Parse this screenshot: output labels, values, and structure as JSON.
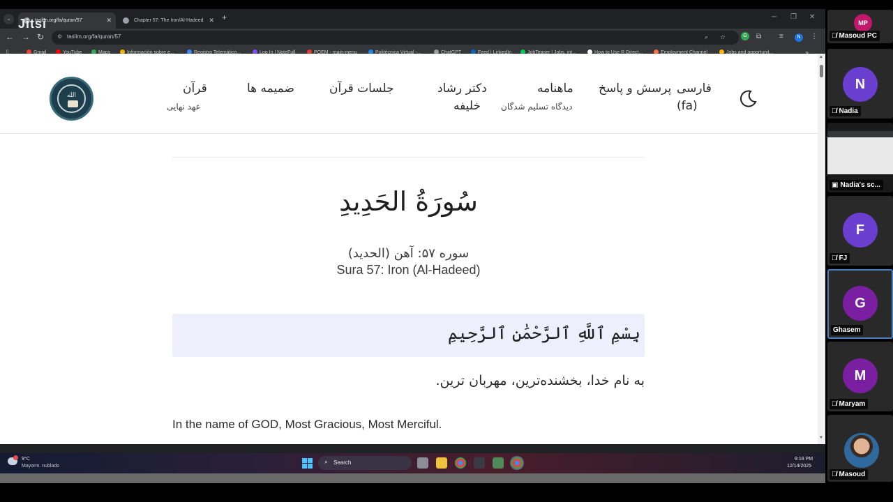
{
  "browser": {
    "tabs": [
      {
        "title": "taslim.org/fa/quran/57",
        "active": true
      },
      {
        "title": "Chapter 57: The Iron/Al-Hadeed",
        "active": false
      }
    ],
    "url": "taslim.org/fa/quran/57",
    "bookmarks": [
      {
        "label": "Gmail",
        "color": "#ea4335"
      },
      {
        "label": "YouTube",
        "color": "#ff0000"
      },
      {
        "label": "Maps",
        "color": "#34a853"
      },
      {
        "label": "Información sobre e...",
        "color": "#f4b400"
      },
      {
        "label": "Registro Telemático...",
        "color": "#4285f4"
      },
      {
        "label": "Log In | NoteFull",
        "color": "#7c4dff"
      },
      {
        "label": "POEM - main-menu",
        "color": "#e53935"
      },
      {
        "label": "Politécnica Virtual -...",
        "color": "#1e88e5"
      },
      {
        "label": "ChatGPT",
        "color": "#9e9e9e"
      },
      {
        "label": "Feed | LinkedIn",
        "color": "#0a66c2"
      },
      {
        "label": "JobTeaser | Jobs, int...",
        "color": "#00c853"
      },
      {
        "label": "How to Use R Direct...",
        "color": "#ffffff"
      },
      {
        "label": "Employment Channel",
        "color": "#ff7043"
      },
      {
        "label": "Jobs and opportunit...",
        "color": "#ffb300"
      }
    ],
    "extensions": [
      "G",
      "N"
    ]
  },
  "jitsi_logo": "Jitsi",
  "site": {
    "nav": {
      "language": "فارسی",
      "language_code": "(fa)",
      "qa": "پرسش و پاسخ",
      "monthly": "ماهنامه",
      "monthly_sub": "دیدگاه تسلیم شدگان",
      "khalifa": "دکتر رشاد",
      "khalifa_2": "خلیفه",
      "sessions": "جلسات قرآن",
      "appendices": "ضمیمه ها",
      "quran": "قرآن",
      "quran_sub": "عهد نهایی"
    },
    "logo_text": "الله"
  },
  "content": {
    "sura_title_ar": "سُورَةُ الحَدِيدِ",
    "sura_sub_fa": "سوره ۵۷: آهن (الحدید)",
    "sura_sub_en": "Sura 57: Iron (Al-Hadeed)",
    "basmala": "بِسْمِ ٱللَّهِ ٱلرَّحْمَٰنِ ٱلرَّحِيمِ",
    "verse_fa": "به نام خدا، بخشنده‌ترین، مهربان ترین.",
    "verse_en": "In the name of GOD, Most Gracious, Most Merciful."
  },
  "taskbar": {
    "temp": "9°C",
    "weather": "Mayorm. nublado",
    "search": "Search",
    "time": "9:18 PM",
    "date": "12/14/2025"
  },
  "participants": [
    {
      "name": "Masoud PC",
      "initials": "MP",
      "color": "#c2186b"
    },
    {
      "name": "Nadia",
      "initials": "N",
      "color": "#6a3fd0"
    },
    {
      "name": "Nadia's sc...",
      "initials": "",
      "color": ""
    },
    {
      "name": "FJ",
      "initials": "F",
      "color": "#6a3fd0"
    },
    {
      "name": "Ghasem",
      "initials": "G",
      "color": "#7b1fa2"
    },
    {
      "name": "Maryam",
      "initials": "M",
      "color": "#7b1fa2"
    },
    {
      "name": "Masoud",
      "initials": "",
      "color": ""
    }
  ]
}
